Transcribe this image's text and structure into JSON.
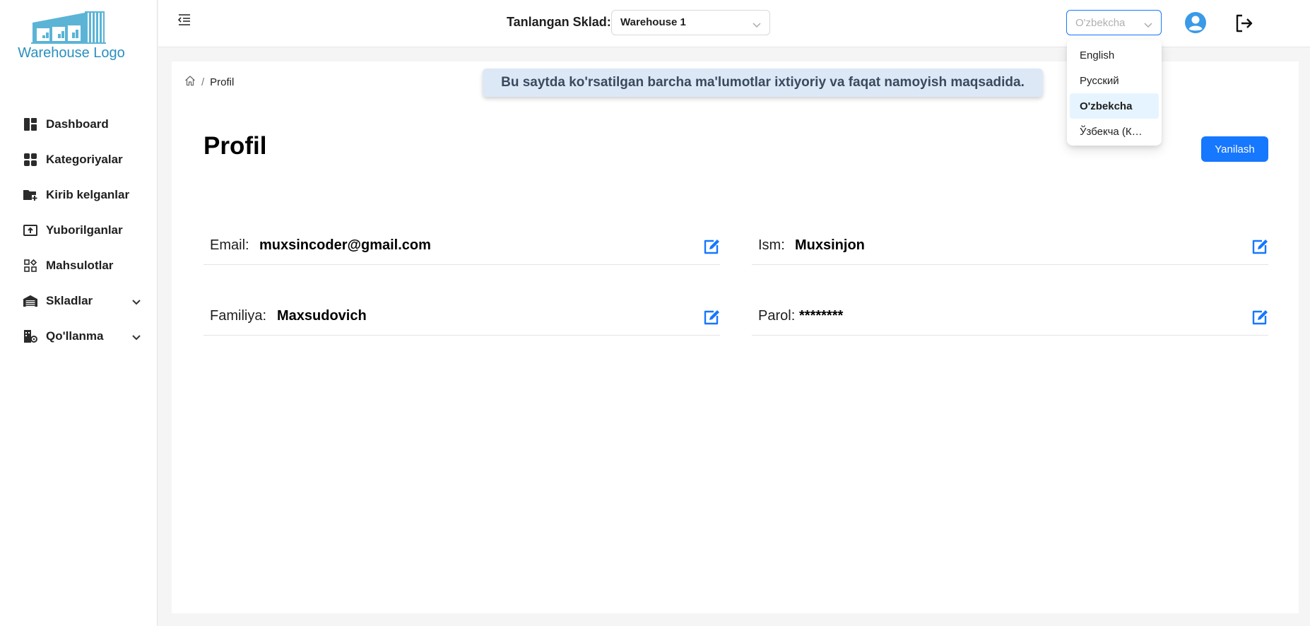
{
  "brand": {
    "logo_text": "Warehouse Logo"
  },
  "sidebar": {
    "items": [
      {
        "label": "Dashboard",
        "icon": "dashboard-icon"
      },
      {
        "label": "Kategoriyalar",
        "icon": "categories-icon"
      },
      {
        "label": "Kirib kelganlar",
        "icon": "folder-plus-icon"
      },
      {
        "label": "Yuborilganlar",
        "icon": "upload-box-icon"
      },
      {
        "label": "Mahsulotlar",
        "icon": "products-icon"
      },
      {
        "label": "Skladlar",
        "icon": "warehouse-icon",
        "expandable": true
      },
      {
        "label": "Qo'llanma",
        "icon": "building-gear-icon",
        "expandable": true
      }
    ]
  },
  "header": {
    "warehouse_label": "Tanlangan Sklad:",
    "warehouse_value": "Warehouse 1",
    "language_value": "O'zbekcha",
    "language_options": [
      "English",
      "Русский",
      "O'zbekcha",
      "Ўзбекча (К…"
    ],
    "language_selected_index": 2
  },
  "breadcrumb": {
    "current": "Profil"
  },
  "notice": "Bu saytda ko'rsatilgan barcha ma'lumotlar ixtiyoriy va faqat namoyish maqsadida.",
  "page": {
    "title": "Profil",
    "refresh_label": "Yanilash"
  },
  "profile": {
    "email": {
      "label": "Email:",
      "value": "muxsincoder@gmail.com"
    },
    "name": {
      "label": "Ism:",
      "value": "Muxsinjon"
    },
    "surname": {
      "label": "Familiya:",
      "value": "Maxsudovich"
    },
    "password": {
      "label": "Parol:",
      "value": "********"
    }
  },
  "colors": {
    "primary": "#1677ff",
    "logo": "#2a8fbf",
    "notice_bg": "#dde8f7"
  }
}
